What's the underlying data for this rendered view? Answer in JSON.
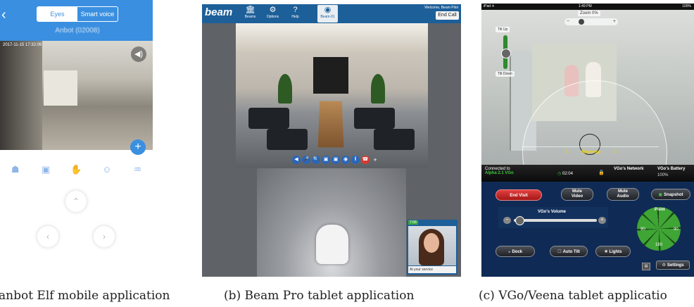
{
  "captions": {
    "a": "anbot Elf mobile application",
    "b": "(b) Beam Pro tablet application",
    "c": "(c) VGo/Veena tablet applicatio"
  },
  "anbot": {
    "back_icon": "chevron-left-icon",
    "tabs": [
      "Eyes",
      "Smart voice"
    ],
    "robot_name": "Anbot (02008)",
    "timestamp": "2017-11-15 17:32:09",
    "speaker_icon": "speaker-icon",
    "plus_icon": "+",
    "toolbar": [
      "footprint",
      "card",
      "hand",
      "face",
      "wave"
    ],
    "dpad": {
      "up": "⌃",
      "left": "‹",
      "right": "›"
    }
  },
  "beam": {
    "logo": "beam",
    "nav": [
      {
        "icon": "🏛",
        "label": "Beams"
      },
      {
        "icon": "⚙",
        "label": "Options"
      },
      {
        "icon": "?",
        "label": "Help"
      },
      {
        "icon": "◉",
        "label": "Beam-01"
      }
    ],
    "welcome": "Welcome, Beam Pilot",
    "end_call": "End Call",
    "controls": [
      "◀",
      "🎤",
      "🔍",
      "▣",
      "▣",
      "◉",
      "‖",
      "☎",
      "+"
    ],
    "pip_badge": "7:58",
    "pip_status": "At your service"
  },
  "vgo": {
    "status_left": "iPad ✈",
    "status_time": "1:49 PM",
    "status_right": "100%",
    "zoom_label": "Zoom 0%",
    "zoom_minus": "−",
    "zoom_plus": "+",
    "tilt_up": "Tilt Up",
    "tilt_down": "Tilt Down",
    "reverse": "Reverse",
    "arrow": "↓",
    "connected_line1": "Connected to",
    "connected_line2": "Alpha 2.1 VGo",
    "timer_icon": "◷",
    "timer": "02:04",
    "network_label": "VGo's Network",
    "battery_label": "VGo's Battery",
    "battery_value": "100%",
    "lock_icon": "🔒",
    "buttons": {
      "end_visit": "End Visit",
      "mute_video_1": "Mute",
      "mute_video_2": "Video",
      "mute_audio_1": "Mute",
      "mute_audio_2": "Audio",
      "snapshot": "Snapshot",
      "dock": "Dock",
      "auto_tilt": "Auto Tilt",
      "lights": "Lights",
      "settings": "Settings"
    },
    "volume_label": "VGo's Volume",
    "volume_minus": "−",
    "volume_plus": "+",
    "pivot_label": "Pivot",
    "pivot_left": "90",
    "pivot_right": "90",
    "pivot_bottom": "180",
    "bottom_icon": "▤"
  }
}
